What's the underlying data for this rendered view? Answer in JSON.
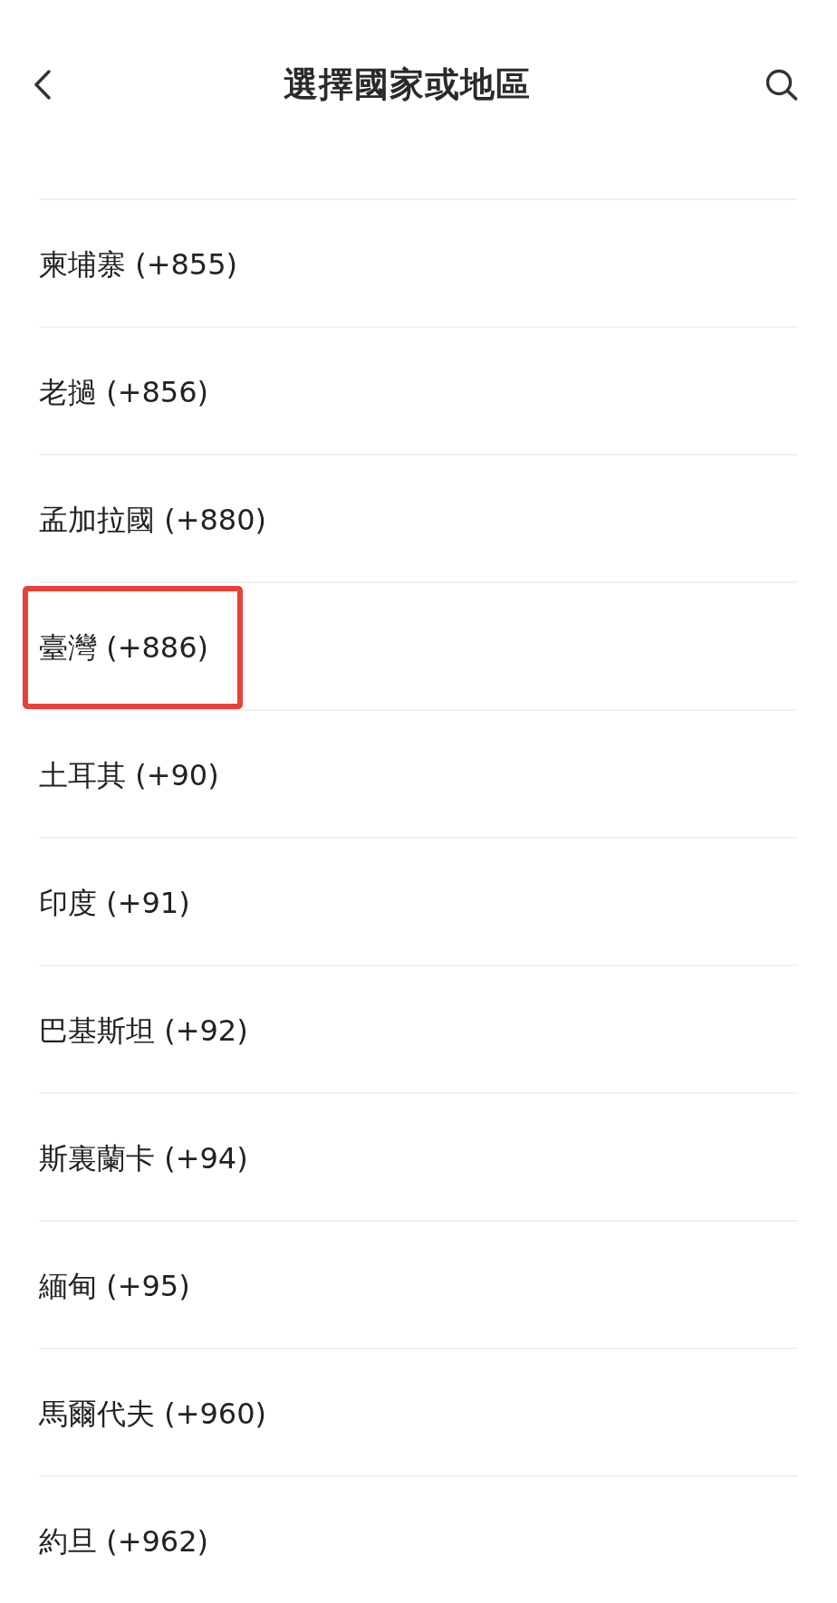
{
  "header": {
    "title": "選擇國家或地區"
  },
  "items": [
    {
      "label": "柬埔寨 (+855)",
      "highlighted": false
    },
    {
      "label": "老撾 (+856)",
      "highlighted": false
    },
    {
      "label": "孟加拉國 (+880)",
      "highlighted": false
    },
    {
      "label": "臺灣 (+886)",
      "highlighted": true
    },
    {
      "label": "土耳其 (+90)",
      "highlighted": false
    },
    {
      "label": "印度 (+91)",
      "highlighted": false
    },
    {
      "label": "巴基斯坦 (+92)",
      "highlighted": false
    },
    {
      "label": "斯裏蘭卡 (+94)",
      "highlighted": false
    },
    {
      "label": "緬甸 (+95)",
      "highlighted": false
    },
    {
      "label": "馬爾代夫 (+960)",
      "highlighted": false
    },
    {
      "label": "約旦 (+962)",
      "highlighted": false
    }
  ]
}
